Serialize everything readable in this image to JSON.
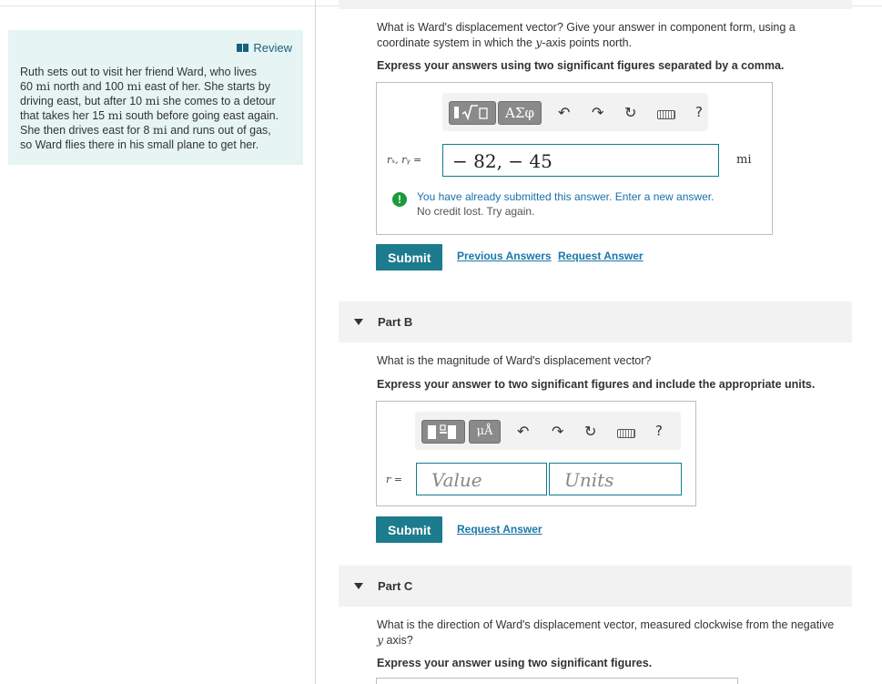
{
  "review": {
    "label": "Review",
    "problem_lines": [
      [
        "Ruth sets out to visit her friend Ward, who lives"
      ],
      [
        "60 ",
        {
          "m": "mi"
        },
        " north and 100 ",
        {
          "m": "mi"
        },
        " east of her. She starts by"
      ],
      [
        "driving east, but after 10 ",
        {
          "m": "mi"
        },
        " she comes to a detour"
      ],
      [
        "that takes her 15 ",
        {
          "m": "mi"
        },
        " south before going east again."
      ],
      [
        "She then drives east for 8 ",
        {
          "m": "mi"
        },
        " and runs out of gas,"
      ],
      [
        "so Ward flies there in his small plane to get her."
      ]
    ]
  },
  "partA": {
    "question_line1_a": "What is Ward's displacement vector? Give your answer in component form, using a",
    "question_line2_a": "coordinate system in which the ",
    "question_line2_var": "y",
    "question_line2_b": "-axis points north.",
    "instruction": "Express your answers using two significant figures separated by a comma.",
    "toolbar": {
      "greek": "ΑΣφ",
      "help": "?"
    },
    "var_label": "rₓ, rᵧ =",
    "answer_value": "− 82, − 45",
    "unit": "mi",
    "warning_line1": "You have already submitted this answer. Enter a new answer.",
    "warning_line2": "No credit lost. Try again.",
    "submit": "Submit",
    "previous_answers": "Previous Answers",
    "request_answer": "Request Answer"
  },
  "partB": {
    "label": "Part B",
    "question": "What is the magnitude of Ward's displacement vector?",
    "instruction": "Express your answer to two significant figures and include the appropriate units.",
    "toolbar": {
      "units": "μÅ",
      "help": "?"
    },
    "var_label": "r =",
    "value_placeholder": "Value",
    "units_placeholder": "Units",
    "submit": "Submit",
    "request_answer": "Request Answer"
  },
  "partC": {
    "label": "Part C",
    "question_line1": "What is the direction of Ward's displacement vector, measured clockwise from the negative",
    "question_line2_var": "y",
    "question_line2_b": " axis?",
    "instruction": "Express your answer using two significant figures."
  }
}
